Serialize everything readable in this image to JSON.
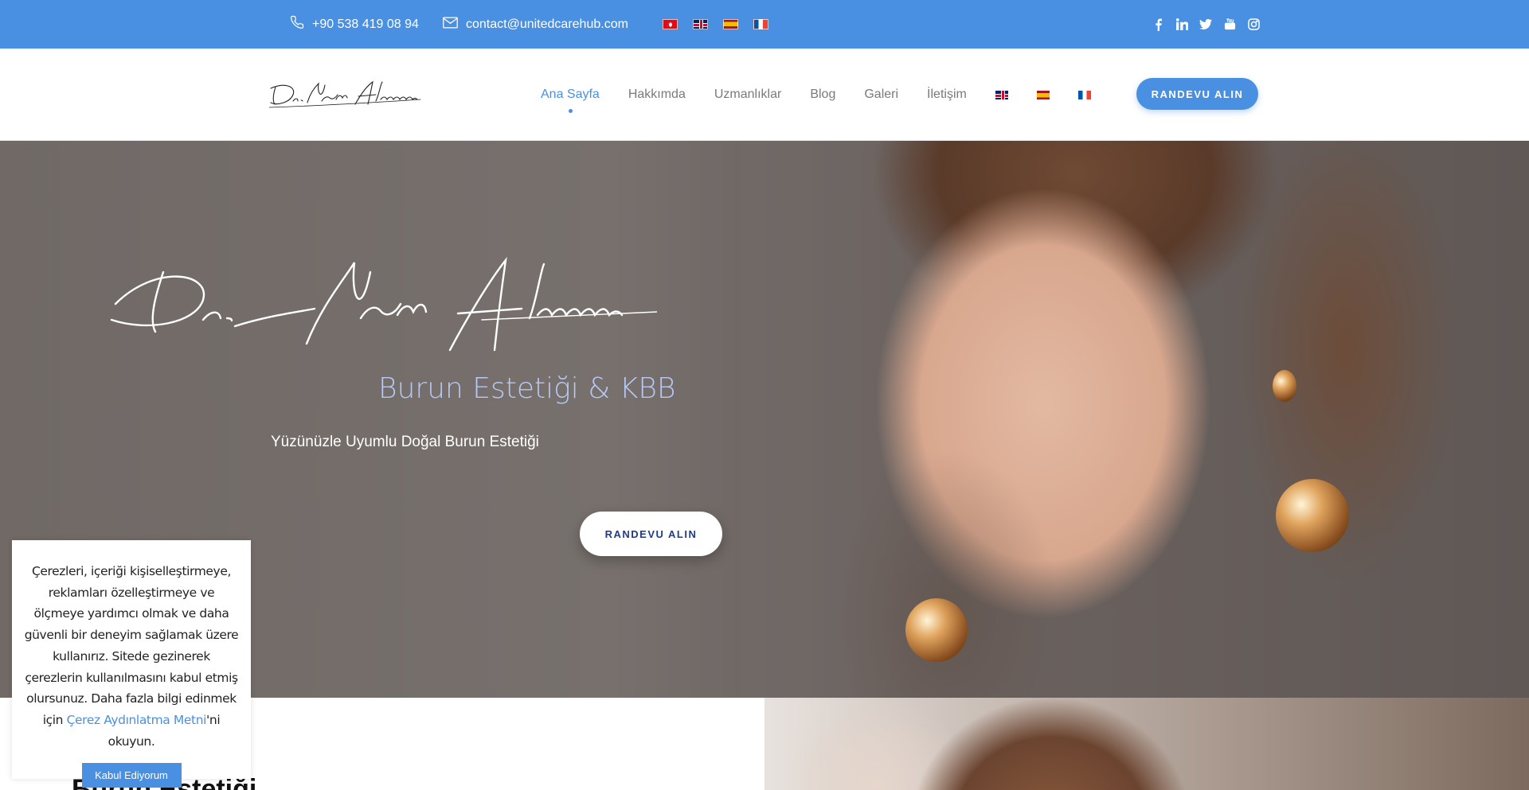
{
  "topbar": {
    "phone": "+90 538 419 08 94",
    "email": "contact@unitedcarehub.com",
    "flags": [
      "flag-tr",
      "flag-gb",
      "flag-es",
      "flag-fr"
    ],
    "social_icons": [
      "facebook-icon",
      "linkedin-icon",
      "twitter-icon",
      "youtube-icon",
      "instagram-icon"
    ],
    "background_color": "#4a90e2"
  },
  "header": {
    "logo_text": "Dr. Niyazi Altıntoprak",
    "nav": [
      {
        "label": "Ana Sayfa",
        "active": true
      },
      {
        "label": "Hakkımda"
      },
      {
        "label": "Uzmanlıklar"
      },
      {
        "label": "Blog"
      },
      {
        "label": "Galeri"
      },
      {
        "label": "İletişim"
      }
    ],
    "nav_flags": [
      "flag-gb",
      "flag-es",
      "flag-fr"
    ],
    "cta": "RANDEVU ALIN",
    "accent_color": "#4a90e2"
  },
  "hero": {
    "signature": "Dr. Niyazi Altıntoprak",
    "subtitle": "Burun Estetiği & KBB",
    "tagline": "Yüzünüzle Uyumlu Doğal Burun Estetiği",
    "cta": "RANDEVU ALIN"
  },
  "section": {
    "title": "Burun Estetiği"
  },
  "cookie": {
    "text_before": "Çerezleri, içeriği kişiselleştirmeye, reklamları özelleştirmeye ve ölçmeye yardımcı olmak ve daha güvenli bir deneyim sağlamak üzere kullanırız. Sitede gezinerek çerezlerin kullanılmasını kabul etmiş olursunuz. Daha fazla bilgi edinmek için ",
    "link": "Çerez Aydınlatma Metni",
    "text_after": "'ni okuyun.",
    "button": "Kabul Ediyorum"
  }
}
